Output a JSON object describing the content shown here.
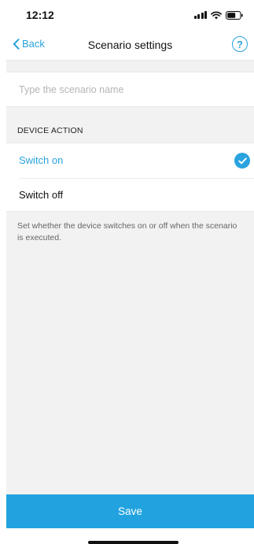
{
  "status_bar": {
    "time": "12:12"
  },
  "nav": {
    "back_label": "Back",
    "title": "Scenario settings",
    "help_label": "?"
  },
  "name_field": {
    "placeholder": "Type the scenario name",
    "value": ""
  },
  "device_action": {
    "header": "DEVICE ACTION",
    "options": [
      {
        "label": "Switch on",
        "selected": true
      },
      {
        "label": "Switch off",
        "selected": false
      }
    ],
    "description": "Set whether the device switches on or off when the scenario is executed."
  },
  "footer": {
    "save_label": "Save"
  },
  "colors": {
    "accent": "#2aa3df",
    "save_button": "#22a3e0",
    "background": "#f2f2f2",
    "surface": "#ffffff"
  },
  "icons": {
    "back": "chevron-left-icon",
    "help": "question-circle-icon",
    "selected": "check-circle-icon",
    "signal": "cellular-signal-icon",
    "wifi": "wifi-icon",
    "battery": "battery-icon"
  }
}
